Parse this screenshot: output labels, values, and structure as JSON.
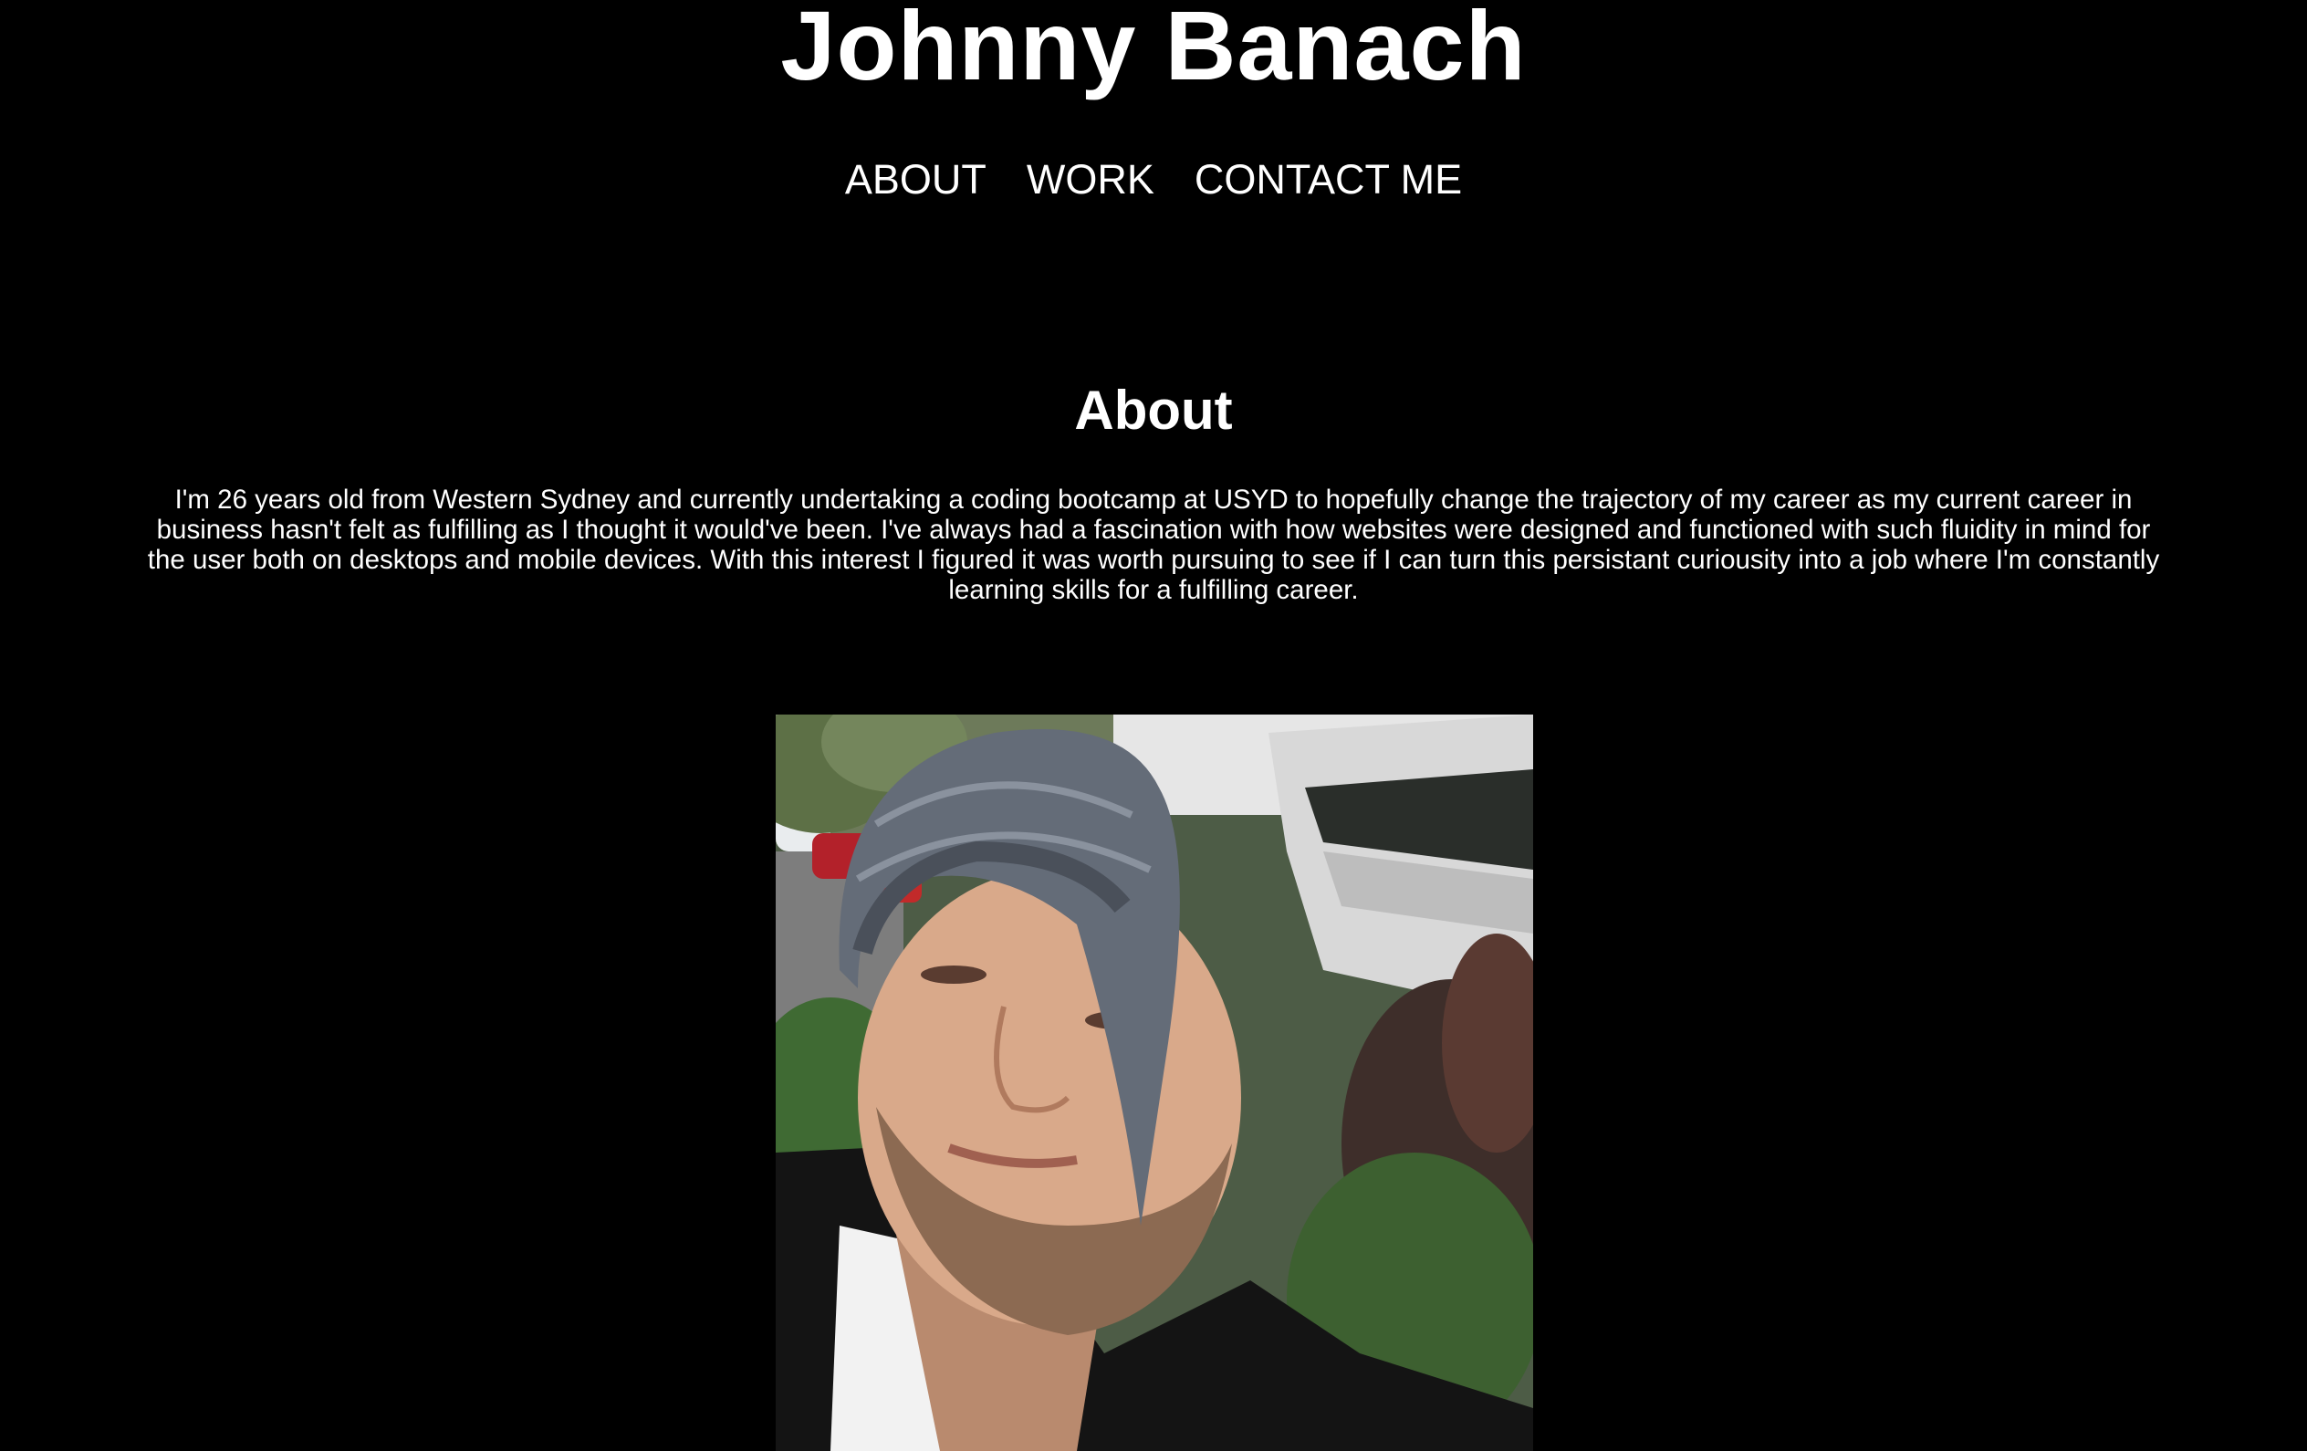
{
  "header": {
    "title": "Johnny Banach"
  },
  "nav": {
    "items": [
      {
        "label": "ABOUT"
      },
      {
        "label": "WORK"
      },
      {
        "label": "CONTACT ME"
      }
    ]
  },
  "about": {
    "heading": "About",
    "body": "I'm 26 years old from Western Sydney and currently undertaking a coding bootcamp at USYD to hopefully change the trajectory of my career as my current career in business hasn't felt as fulfilling as I thought it would've been. I've always had a fascination with how websites were designed and functioned with such fluidity in mind for the user both on desktops and mobile devices. With this interest I figured it was worth pursuing to see if I can turn this persistant curiousity into a job where I'm constantly learning skills for a fulfilling career."
  },
  "colors": {
    "background": "#000000",
    "text": "#ffffff"
  }
}
